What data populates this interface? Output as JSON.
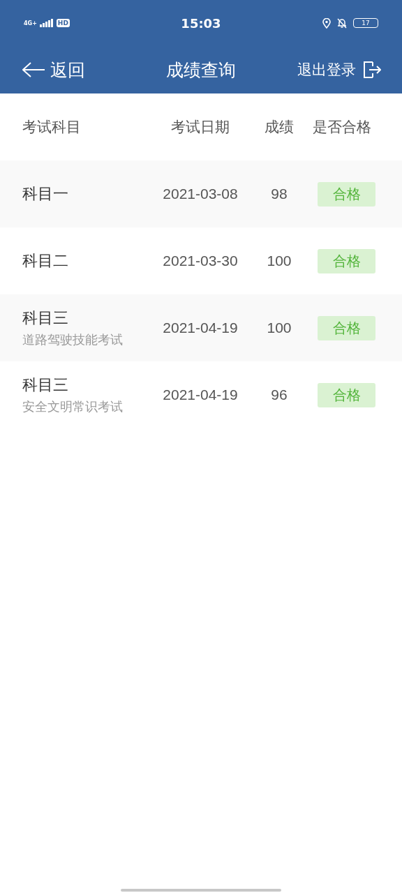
{
  "status_bar": {
    "network": "4G+",
    "hd": "HD",
    "time": "15:03",
    "battery": "17"
  },
  "nav": {
    "back": "返回",
    "title": "成绩查询",
    "logout": "退出登录"
  },
  "table": {
    "columns": [
      "考试科目",
      "考试日期",
      "成绩",
      "是否合格"
    ],
    "rows": [
      {
        "subject": "科目一",
        "date": "2021-03-08",
        "score": "98",
        "result": "合格",
        "kind": "pass"
      },
      {
        "subject": "科目二",
        "date": "2021-03-30",
        "score": "100",
        "result": "合格",
        "kind": "pass"
      },
      {
        "subject": "科目三",
        "note": "道路驾驶技能考试",
        "date": "2021-04-19",
        "score": "100",
        "result": "合格",
        "kind": "pass"
      },
      {
        "subject": "科目三",
        "note": "安全文明常识考试",
        "date": "2021-04-19",
        "score": "96",
        "result": "合格",
        "kind": "pass"
      }
    ]
  }
}
